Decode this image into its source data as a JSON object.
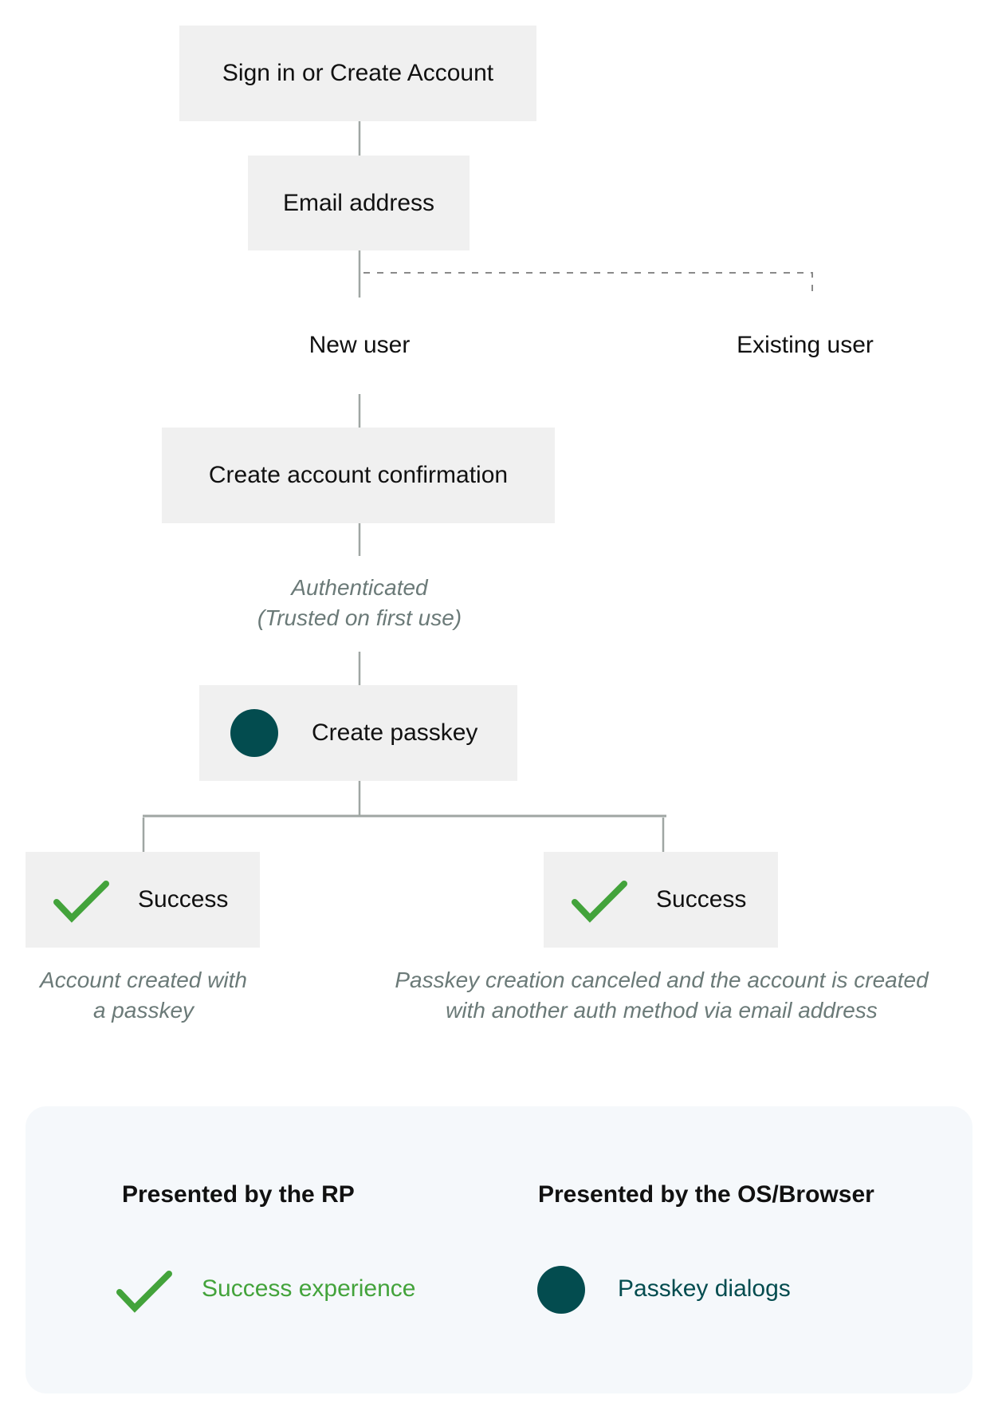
{
  "colors": {
    "node_bg": "#f0f0f0",
    "connector": "#9fa6a3",
    "dashed_connector": "#8a8a8a",
    "caption_text": "#6b7a78",
    "success_green": "#43a33b",
    "passkey_teal": "#034c4f",
    "legend_bg": "#f5f8fb"
  },
  "flow": {
    "start": "Sign in or Create Account",
    "email": "Email address",
    "branch_new_user": "New user",
    "branch_existing_user": "Existing user",
    "confirm": "Create account confirmation",
    "auth_caption": [
      "Authenticated",
      "(Trusted on first use)"
    ],
    "create_passkey": {
      "label": "Create passkey",
      "icon": "passkey-dialog-dot-icon"
    },
    "outcomes": [
      {
        "label": "Success",
        "icon": "checkmark-icon",
        "caption": [
          "Account created with",
          "a passkey"
        ]
      },
      {
        "label": "Success",
        "icon": "checkmark-icon",
        "caption": [
          "Passkey creation canceled and the account is created",
          "with another auth method via email address"
        ]
      }
    ]
  },
  "legend": {
    "rp": {
      "title": "Presented by the RP",
      "item_label": "Success experience",
      "item_icon": "checkmark-icon"
    },
    "os": {
      "title": "Presented by the OS/Browser",
      "item_label": "Passkey dialogs",
      "item_icon": "passkey-dialog-dot-icon"
    }
  }
}
